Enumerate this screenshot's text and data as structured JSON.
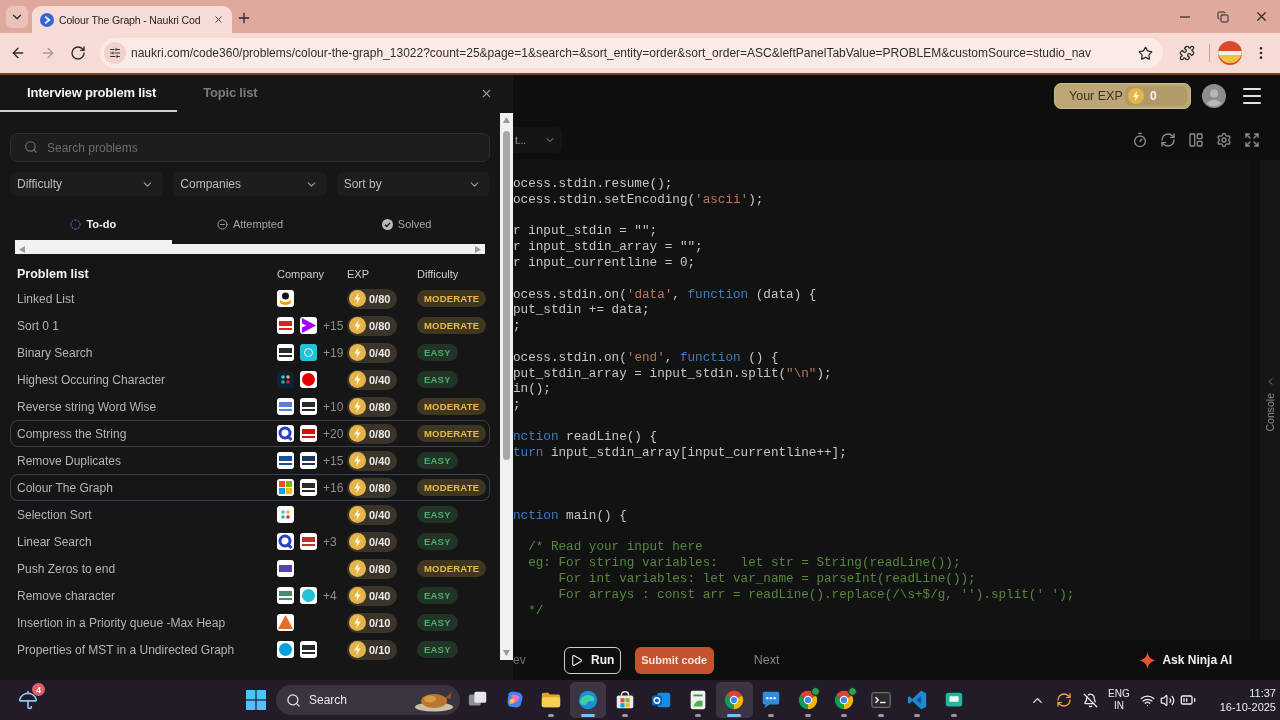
{
  "browser": {
    "tab": {
      "title": "Colour The Graph - Naukri Cod",
      "selected": true
    },
    "nav_buttons": [
      {
        "kind": "back",
        "disabled": false
      },
      {
        "kind": "forward",
        "disabled": true
      },
      {
        "kind": "reload",
        "disabled": false
      }
    ],
    "url": "naukri.com/code360/problems/colour-the-graph_13022?count=25&page=1&search=&sort_entity=order&sort_order=ASC&leftPanelTabValue=PROBLEM&customSource=studio_nav"
  },
  "problem_panel": {
    "tabs": [
      {
        "label": "Interview problem list",
        "selected": true
      },
      {
        "label": "Topic list",
        "selected": false
      }
    ],
    "search": {
      "placeholder": "Search problems"
    },
    "filters": [
      {
        "label": "Difficulty"
      },
      {
        "label": "Companies"
      },
      {
        "label": "Sort by"
      }
    ],
    "status_tabs": [
      {
        "label": "To-do",
        "kind": "todo",
        "selected": true
      },
      {
        "label": "Attempted",
        "kind": "attempted",
        "selected": false
      },
      {
        "label": "Solved",
        "kind": "solved",
        "selected": false
      }
    ],
    "table": {
      "columns": [
        "Problem list",
        "Company",
        "EXP",
        "Difficulty"
      ],
      "rows": [
        {
          "title": "Linked List",
          "company_logos": [
            {
              "kind": "smile",
              "color": "#ff9900"
            }
          ],
          "exp": "0/80",
          "difficulty": {
            "label": "MODERATE",
            "color": "#403720"
          },
          "selected": false,
          "hovered": false
        },
        {
          "title": "Sort 0 1",
          "company_logos": [
            {
              "kind": "wordmark",
              "color": "#e02020"
            },
            {
              "kind": "chevron",
              "color": "#a100ff"
            }
          ],
          "more_companies": "+15",
          "exp": "0/80",
          "difficulty": {
            "label": "MODERATE",
            "color": "#403720"
          },
          "selected": false,
          "hovered": false
        },
        {
          "title": "Binary Search",
          "company_logos": [
            {
              "kind": "wordmark",
              "color": "#2a2a2a"
            },
            {
              "kind": "tile",
              "color": "#22c3d9"
            }
          ],
          "more_companies": "+19",
          "exp": "0/40",
          "difficulty": {
            "label": "EASY",
            "color": "#213427"
          },
          "selected": false,
          "hovered": false
        },
        {
          "title": "Highest Occuring Character",
          "company_logos": [
            {
              "kind": "dots",
              "color": "#0d2238"
            },
            {
              "kind": "disc",
              "color": "#e40000"
            }
          ],
          "exp": "0/40",
          "difficulty": {
            "label": "EASY",
            "color": "#213427"
          },
          "selected": false,
          "hovered": false
        },
        {
          "title": "Reverse string Word Wise",
          "company_logos": [
            {
              "kind": "wordmark",
              "color": "#5b7fd0"
            },
            {
              "kind": "wordmark",
              "color": "#2a2a2a"
            }
          ],
          "more_companies": "+10",
          "exp": "0/80",
          "difficulty": {
            "label": "MODERATE",
            "color": "#403720"
          },
          "selected": false,
          "hovered": false
        },
        {
          "title": "Compress the String",
          "company_logos": [
            {
              "kind": "ring",
              "color": "#2a3fc9"
            },
            {
              "kind": "wordmark",
              "color": "#d01010"
            }
          ],
          "more_companies": "+20",
          "exp": "0/80",
          "difficulty": {
            "label": "MODERATE",
            "color": "#403720"
          },
          "selected": false,
          "hovered": true
        },
        {
          "title": "Remove Duplicates",
          "company_logos": [
            {
              "kind": "wordmark",
              "color": "#1a4fa0"
            },
            {
              "kind": "wordmark",
              "color": "#1d3557"
            }
          ],
          "more_companies": "+15",
          "exp": "0/40",
          "difficulty": {
            "label": "EASY",
            "color": "#213427"
          },
          "selected": false,
          "hovered": false
        },
        {
          "title": "Colour The Graph",
          "company_logos": [
            {
              "kind": "grid"
            },
            {
              "kind": "wordmark",
              "color": "#2a2a2a"
            }
          ],
          "more_companies": "+16",
          "exp": "0/80",
          "difficulty": {
            "label": "MODERATE",
            "color": "#403720"
          },
          "selected": true,
          "hovered": false
        },
        {
          "title": "Selection Sort",
          "company_logos": [
            {
              "kind": "dots",
              "color": "#ffffff"
            }
          ],
          "exp": "0/40",
          "difficulty": {
            "label": "EASY",
            "color": "#213427"
          },
          "selected": false,
          "hovered": false
        },
        {
          "title": "Linear Search",
          "company_logos": [
            {
              "kind": "ring",
              "color": "#2a3fc9"
            },
            {
              "kind": "wordmark",
              "color": "#c03030"
            }
          ],
          "more_companies": "+3",
          "exp": "0/40",
          "difficulty": {
            "label": "EASY",
            "color": "#213427"
          },
          "selected": false,
          "hovered": false
        },
        {
          "title": "Push Zeros to end",
          "company_logos": [
            {
              "kind": "band",
              "color": "#5b3fb8"
            }
          ],
          "exp": "0/80",
          "difficulty": {
            "label": "MODERATE",
            "color": "#403720"
          },
          "selected": false,
          "hovered": false
        },
        {
          "title": "Remove character",
          "company_logos": [
            {
              "kind": "wordmark",
              "color": "#4a8a6a"
            },
            {
              "kind": "disc",
              "color": "#22c3d9"
            }
          ],
          "more_companies": "+4",
          "exp": "0/40",
          "difficulty": {
            "label": "EASY",
            "color": "#213427"
          },
          "selected": false,
          "hovered": false
        },
        {
          "title": "Insertion in a Priority queue -Max Heap",
          "company_logos": [
            {
              "kind": "triangle",
              "color": "#e0702a"
            }
          ],
          "exp": "0/10",
          "difficulty": {
            "label": "EASY",
            "color": "#213427"
          },
          "selected": false,
          "hovered": false
        },
        {
          "title": "Properties of MST in a Undirected Graph",
          "company_logos": [
            {
              "kind": "disc",
              "color": "#00a3e0"
            },
            {
              "kind": "wordmark",
              "color": "#2a2a2a"
            }
          ],
          "exp": "0/10",
          "difficulty": {
            "label": "EASY",
            "color": "#213427"
          },
          "selected": false,
          "hovered": false
        }
      ]
    }
  },
  "editor": {
    "exp": {
      "label": "Your EXP",
      "value": "0"
    },
    "language": "t...",
    "code_lines": [
      {
        "kind": "flush",
        "tokens": [
          {
            "kind": "plain",
            "text": "ocess.stdin.resume();"
          }
        ]
      },
      {
        "kind": "flush",
        "tokens": [
          {
            "kind": "plain",
            "text": "ocess.stdin.setEncoding("
          },
          {
            "kind": "string",
            "text": "'ascii'"
          },
          {
            "kind": "plain",
            "text": ");"
          }
        ]
      },
      {
        "kind": "blank"
      },
      {
        "kind": "flush",
        "tokens": [
          {
            "kind": "plain",
            "text": "r input_stdin = \"\";"
          }
        ]
      },
      {
        "kind": "flush",
        "tokens": [
          {
            "kind": "plain",
            "text": "r input_stdin_array = \"\";"
          }
        ]
      },
      {
        "kind": "flush",
        "tokens": [
          {
            "kind": "plain",
            "text": "r input_currentline = 0;"
          }
        ]
      },
      {
        "kind": "blank"
      },
      {
        "kind": "flush",
        "tokens": [
          {
            "kind": "plain",
            "text": "ocess.stdin.on("
          },
          {
            "kind": "string",
            "text": "'data'"
          },
          {
            "kind": "plain",
            "text": ", "
          },
          {
            "kind": "keyword",
            "text": "function"
          },
          {
            "kind": "plain",
            "text": " (data) {"
          }
        ]
      },
      {
        "kind": "flush",
        "tokens": [
          {
            "kind": "plain",
            "text": "put_stdin += data;"
          }
        ]
      },
      {
        "kind": "flush",
        "tokens": [
          {
            "kind": "plain",
            "text": ";"
          }
        ]
      },
      {
        "kind": "blank"
      },
      {
        "kind": "flush",
        "tokens": [
          {
            "kind": "plain",
            "text": "ocess.stdin.on("
          },
          {
            "kind": "string",
            "text": "'end'"
          },
          {
            "kind": "plain",
            "text": ", "
          },
          {
            "kind": "keyword",
            "text": "function"
          },
          {
            "kind": "plain",
            "text": " () {"
          }
        ]
      },
      {
        "kind": "flush",
        "tokens": [
          {
            "kind": "plain",
            "text": "put_stdin_array = input_stdin.split("
          },
          {
            "kind": "string",
            "text": "\"\\n\""
          },
          {
            "kind": "plain",
            "text": ");"
          }
        ]
      },
      {
        "kind": "flush",
        "tokens": [
          {
            "kind": "plain",
            "text": "in();"
          }
        ]
      },
      {
        "kind": "flush",
        "tokens": [
          {
            "kind": "plain",
            "text": ";"
          }
        ]
      },
      {
        "kind": "blank"
      },
      {
        "kind": "flush",
        "tokens": [
          {
            "kind": "keyword",
            "text": "nction"
          },
          {
            "kind": "plain",
            "text": " readLine() {"
          }
        ]
      },
      {
        "kind": "flush",
        "tokens": [
          {
            "kind": "keyword",
            "text": "turn"
          },
          {
            "kind": "plain",
            "text": " input_stdin_array[input_currentline++];"
          }
        ]
      },
      {
        "kind": "blank"
      },
      {
        "kind": "blank"
      },
      {
        "kind": "blank"
      },
      {
        "kind": "flush",
        "tokens": [
          {
            "kind": "keyword",
            "text": "nction"
          },
          {
            "kind": "plain",
            "text": " main() {"
          }
        ]
      },
      {
        "kind": "blank"
      },
      {
        "kind": "indented",
        "tokens": [
          {
            "kind": "comment",
            "text": "/* Read your input here"
          }
        ]
      },
      {
        "kind": "indented",
        "tokens": [
          {
            "kind": "comment",
            "text": "eg: For string variables:   let str = String(readLine());"
          }
        ]
      },
      {
        "kind": "nested",
        "tokens": [
          {
            "kind": "comment",
            "text": "For int variables: let var_name = parseInt(readLine());"
          }
        ]
      },
      {
        "kind": "nested",
        "tokens": [
          {
            "kind": "comment",
            "text": "For arrays : const arr = readLine().replace(/\\s+$/g, '').split(' ');"
          }
        ]
      },
      {
        "kind": "indented",
        "tokens": [
          {
            "kind": "comment",
            "text": "*/"
          }
        ]
      }
    ],
    "console_label": "Console",
    "footer": {
      "prev": "ev",
      "run": "Run",
      "submit": "Submit code",
      "next": "Next",
      "ask_ai": "Ask Ninja AI"
    }
  },
  "taskbar": {
    "weather_badge": "4",
    "search_label": "Search",
    "apps": [
      {
        "kind": "taskview",
        "running": false,
        "highlighted": false,
        "badge": false
      },
      {
        "kind": "assistant",
        "running": false,
        "highlighted": false,
        "badge": false
      },
      {
        "kind": "folder",
        "running": true,
        "highlighted": false,
        "badge": false
      },
      {
        "kind": "wave",
        "running": true,
        "highlighted": true,
        "badge": false
      },
      {
        "kind": "store",
        "running": true,
        "highlighted": false,
        "badge": false
      },
      {
        "kind": "mail",
        "running": false,
        "highlighted": false,
        "badge": false
      },
      {
        "kind": "sheet",
        "running": true,
        "highlighted": false,
        "badge": false
      },
      {
        "kind": "browser",
        "running": true,
        "highlighted": true,
        "badge": false
      },
      {
        "kind": "help",
        "running": true,
        "highlighted": false,
        "badge": false
      },
      {
        "kind": "browser",
        "running": true,
        "highlighted": false,
        "badge": true
      },
      {
        "kind": "browser",
        "running": true,
        "highlighted": false,
        "badge": true
      },
      {
        "kind": "terminal",
        "running": true,
        "highlighted": false,
        "badge": false
      },
      {
        "kind": "editor",
        "running": true,
        "highlighted": false,
        "badge": false
      },
      {
        "kind": "meet",
        "running": true,
        "highlighted": false,
        "badge": false
      }
    ],
    "tray": {
      "language": "ENG",
      "region": "IN",
      "time": "11:37",
      "date": "16-10-2025"
    }
  }
}
